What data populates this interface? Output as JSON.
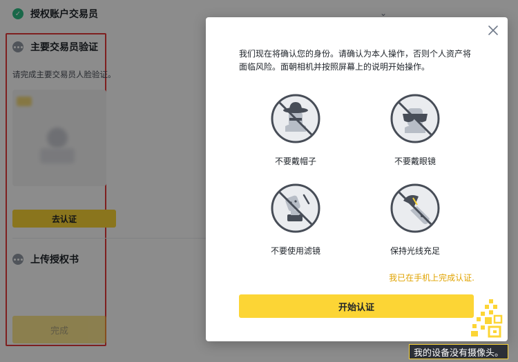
{
  "background": {
    "steps": [
      {
        "label": "授权账户交易员"
      },
      {
        "label": "主要交易员验证"
      },
      {
        "label": "上传授权书"
      }
    ],
    "description": "请完成主要交易员人脸验证。",
    "verify_button": "去认证",
    "done_button": "完成"
  },
  "modal": {
    "intro": "我们现在将确认您的身份。请确认为本人操作，否则个人资产将面临风险。面朝相机并按照屏幕上的说明开始操作。",
    "tips": [
      {
        "label": "不要戴帽子",
        "icon": "no-hat-icon"
      },
      {
        "label": "不要戴眼镜",
        "icon": "no-glasses-icon"
      },
      {
        "label": "不要使用滤镜",
        "icon": "no-filter-icon"
      },
      {
        "label": "保持光线充足",
        "icon": "good-lighting-icon"
      }
    ],
    "phone_link": "我已在手机上完成认证.",
    "start_button": "开始认证"
  },
  "no_camera_link": "我的设备没有摄像头。",
  "colors": {
    "accent": "#fcd535",
    "link": "#e0a300",
    "success": "#2ebd85",
    "highlight": "#e63a3a"
  }
}
